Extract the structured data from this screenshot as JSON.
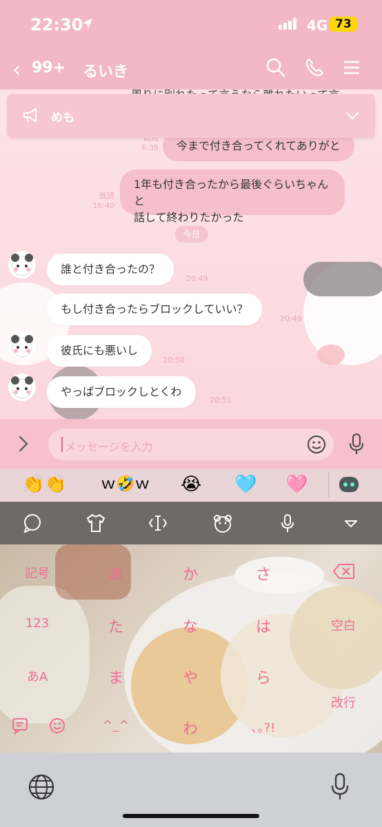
{
  "status": {
    "time": "22:30",
    "network": "4G",
    "battery": "73"
  },
  "header": {
    "back_count": "99+",
    "chat_name": "るいき"
  },
  "memo": {
    "label": "めも"
  },
  "messages": {
    "partial_top": "周りに別れたって言うなら離れたいって言",
    "m1": {
      "text": "今まで付き合ってくれてありがと",
      "read": "既読",
      "time": "6:39"
    },
    "m2": {
      "line1": "1年も付き合ったから最後ぐらいちゃんと",
      "line2": "話して終わりたかった",
      "read": "既読",
      "time": "16:40"
    },
    "date_label": "今日",
    "i1": {
      "text": "誰と付き合ったの？",
      "time": "20:49"
    },
    "i2": {
      "text": "もし付き合ったらブロックしていい？",
      "time": "20:49"
    },
    "i3": {
      "text": "彼氏にも悪いし",
      "time": "20:50"
    },
    "i4": {
      "text": "やっぱブロックしとくわ",
      "time": "20:51"
    }
  },
  "input": {
    "placeholder": "メッセージを入力"
  },
  "emoji_suggestions": [
    "👏👏",
    "ｗ🤣ｗ",
    "😭",
    "🩵",
    "🩷"
  ],
  "keyboard": {
    "keys": {
      "symbols": "記号",
      "a": "あ",
      "ka": "か",
      "sa": "さ",
      "num": "123",
      "ta": "た",
      "na": "な",
      "ha": "は",
      "space": "空白",
      "mode": "あA",
      "ma": "ま",
      "ya": "や",
      "ra": "ら",
      "enter": "改行",
      "kaomoji": "^_^",
      "wa": "わ",
      "punct": "､｡?!"
    }
  },
  "colors": {
    "header": "#f2b8c5",
    "bubble_out": "#f5bfcb",
    "key_text": "#ec6d93"
  }
}
